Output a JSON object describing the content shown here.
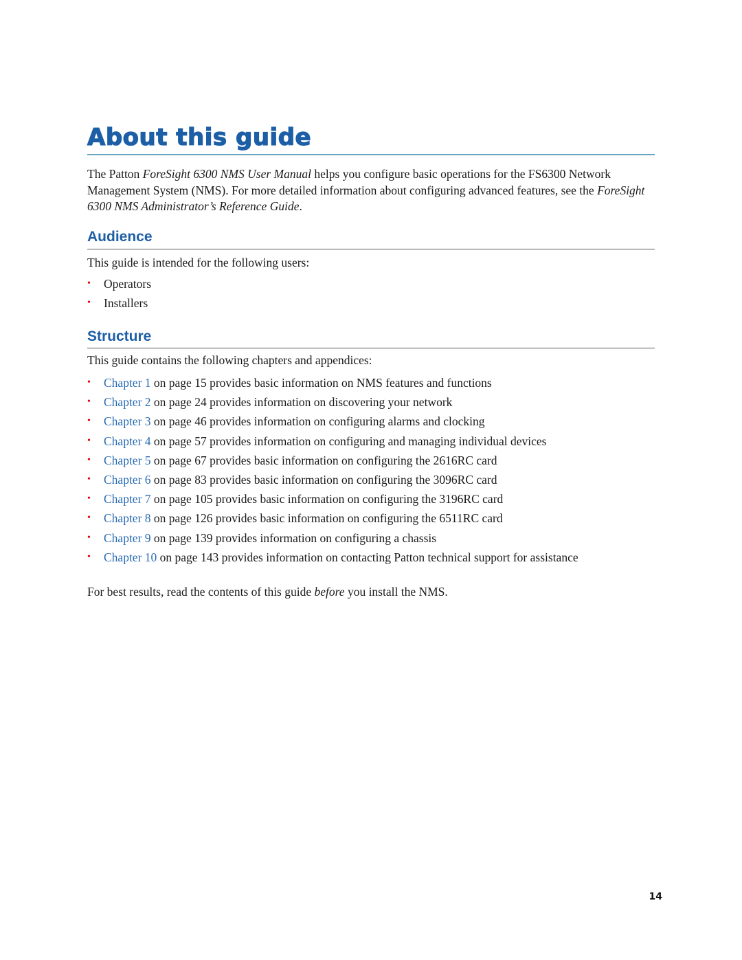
{
  "title": "About this guide",
  "intro": {
    "part1": "The Patton ",
    "manual_title": "ForeSight 6300 NMS User Manual",
    "part2": " helps you configure basic operations for the FS6300 Network Management System (NMS). For more detailed information about configuring advanced features, see the ",
    "ref_guide_title": "ForeSight 6300 NMS Administrator’s Reference Guide",
    "part3": "."
  },
  "audience": {
    "heading": "Audience",
    "lead": "This guide is intended for the following users:",
    "items": [
      "Operators",
      "Installers"
    ]
  },
  "structure": {
    "heading": "Structure",
    "lead": "This guide contains the following chapters and appendices:",
    "chapters": [
      {
        "link": "Chapter 1",
        "text": " on page 15 provides basic information on NMS features and functions"
      },
      {
        "link": "Chapter 2",
        "text": " on page 24 provides information on discovering your network"
      },
      {
        "link": "Chapter 3",
        "text": " on page 46 provides information on configuring alarms and clocking"
      },
      {
        "link": "Chapter 4",
        "text": " on page 57 provides information on configuring and managing individual devices"
      },
      {
        "link": "Chapter 5",
        "text": " on page 67 provides basic information on configuring the 2616RC card"
      },
      {
        "link": "Chapter 6",
        "text": " on page 83 provides basic information on configuring the 3096RC card"
      },
      {
        "link": "Chapter 7",
        "text": " on page 105 provides basic information on configuring the 3196RC card"
      },
      {
        "link": "Chapter 8",
        "text": " on page 126 provides basic information on configuring the 6511RC card"
      },
      {
        "link": "Chapter 9",
        "text": " on page 139 provides information on configuring a chassis"
      },
      {
        "link": "Chapter 10",
        "text": " on page 143 provides information on contacting Patton technical support for assistance"
      }
    ]
  },
  "closing": {
    "part1": "For best results, read the contents of this guide ",
    "emphasis": "before",
    "part2": " you install the NMS."
  },
  "bullet_glyph": "•",
  "page_number": "14",
  "colors": {
    "heading": "#1d5fa6",
    "link": "#2a6cb3",
    "bullet": "#e00000",
    "title_rule": "#6aa5c4",
    "section_rule": "#555555"
  }
}
